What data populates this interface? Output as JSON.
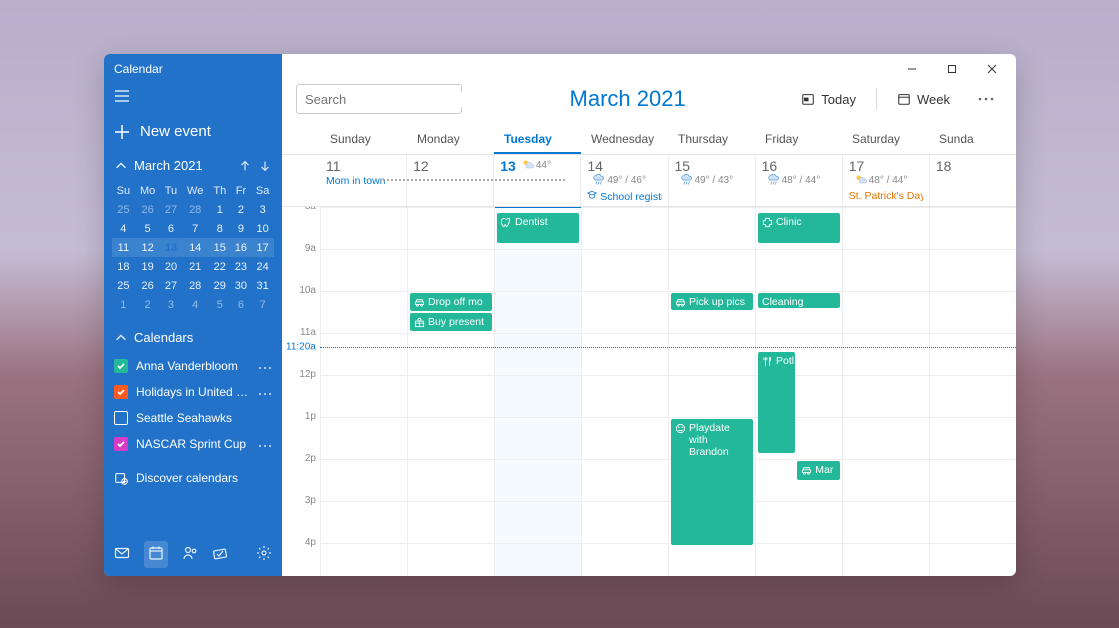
{
  "app_title": "Calendar",
  "sidebar": {
    "new_event_label": "New event",
    "month_label": "March 2021",
    "dow": [
      "Su",
      "Mo",
      "Tu",
      "We",
      "Th",
      "Fr",
      "Sa"
    ],
    "weeks": [
      {
        "days": [
          {
            "n": 25,
            "dim": true
          },
          {
            "n": 26,
            "dim": true
          },
          {
            "n": 27,
            "dim": true
          },
          {
            "n": 28,
            "dim": true
          },
          {
            "n": 1
          },
          {
            "n": 2
          },
          {
            "n": 3
          }
        ]
      },
      {
        "days": [
          {
            "n": 4
          },
          {
            "n": 5
          },
          {
            "n": 6
          },
          {
            "n": 7
          },
          {
            "n": 8
          },
          {
            "n": 9
          },
          {
            "n": 10
          }
        ]
      },
      {
        "cur": true,
        "days": [
          {
            "n": 11
          },
          {
            "n": 12
          },
          {
            "n": 13,
            "today": true
          },
          {
            "n": 14
          },
          {
            "n": 15
          },
          {
            "n": 16
          },
          {
            "n": 17
          }
        ]
      },
      {
        "days": [
          {
            "n": 18
          },
          {
            "n": 19
          },
          {
            "n": 20
          },
          {
            "n": 21
          },
          {
            "n": 22
          },
          {
            "n": 23
          },
          {
            "n": 24
          }
        ]
      },
      {
        "days": [
          {
            "n": 25
          },
          {
            "n": 26
          },
          {
            "n": 27
          },
          {
            "n": 28
          },
          {
            "n": 29
          },
          {
            "n": 30
          },
          {
            "n": 31
          }
        ]
      },
      {
        "days": [
          {
            "n": 1,
            "dim": true
          },
          {
            "n": 2,
            "dim": true
          },
          {
            "n": 3,
            "dim": true
          },
          {
            "n": 4,
            "dim": true
          },
          {
            "n": 5,
            "dim": true
          },
          {
            "n": 6,
            "dim": true
          },
          {
            "n": 7,
            "dim": true
          }
        ]
      }
    ],
    "calendars_label": "Calendars",
    "calendars": [
      {
        "label": "Anna Vanderbloom",
        "color": "#23b89a",
        "checked": true,
        "dots": true
      },
      {
        "label": "Holidays in United States",
        "color": "#ff5a1f",
        "checked": true,
        "dots": true
      },
      {
        "label": "Seattle Seahawks",
        "color": "#ffffff",
        "checked": false,
        "dots": false
      },
      {
        "label": "NASCAR Sprint Cup",
        "color": "#d63cc6",
        "checked": true,
        "dots": true
      }
    ],
    "discover_label": "Discover calendars"
  },
  "toolbar": {
    "search_placeholder": "Search",
    "title": "March 2021",
    "today_label": "Today",
    "week_label": "Week"
  },
  "day_headers": [
    "Sunday",
    "Monday",
    "Tuesday",
    "Wednesday",
    "Thursday",
    "Friday",
    "Saturday",
    "Sunda"
  ],
  "selected_day_index": 2,
  "dates": [
    {
      "num": "11",
      "allday": {
        "text": "Mom in town",
        "style": "link",
        "bar_after": true
      }
    },
    {
      "num": "12"
    },
    {
      "num": "13",
      "today": true,
      "weather": "44°",
      "wicon": "sun-cloud"
    },
    {
      "num": "14",
      "weather": "49° / 46°",
      "wicon": "rain",
      "allday": {
        "text": "School registrati",
        "style": "link",
        "icon": "grad"
      }
    },
    {
      "num": "15",
      "weather": "49° / 43°",
      "wicon": "rain"
    },
    {
      "num": "16",
      "weather": "48° / 44°",
      "wicon": "rain"
    },
    {
      "num": "17",
      "weather": "48° / 44°",
      "wicon": "sun-cloud",
      "allday": {
        "text": "St. Patrick's Day",
        "style": "holiday"
      }
    },
    {
      "num": "18"
    }
  ],
  "hours": [
    "8a",
    "9a",
    "10a",
    "11a",
    "12p",
    "1p",
    "2p",
    "3p",
    "4p"
  ],
  "now": {
    "label": "11:20a",
    "offset_hours": 3.33
  },
  "events": [
    {
      "day": 2,
      "label": "Dentist",
      "icon": "tooth",
      "start": 0.1,
      "dur": 0.8
    },
    {
      "day": 1,
      "stack": true,
      "start": 2,
      "items": [
        {
          "label": "Drop off mo",
          "icon": "car"
        },
        {
          "label": "Buy present",
          "icon": "gift"
        }
      ]
    },
    {
      "day": 4,
      "label": "Pick up pics",
      "icon": "car",
      "start": 2,
      "dur": 0.5
    },
    {
      "day": 4,
      "label": "Playdate with Brandon",
      "icon": "play",
      "start": 5,
      "dur": 3.1
    },
    {
      "day": 5,
      "label": "Clinic",
      "icon": "plus",
      "start": 0.1,
      "dur": 0.8
    },
    {
      "day": 5,
      "label": "Cleaning",
      "start": 2,
      "dur": 0.45
    },
    {
      "day": 5,
      "label": "Potl",
      "icon": "food",
      "start": 3.4,
      "dur": 2.5,
      "narrow": "left"
    },
    {
      "day": 5,
      "label": "Mar",
      "icon": "car",
      "start": 6,
      "dur": 0.55,
      "narrow": "right"
    }
  ]
}
